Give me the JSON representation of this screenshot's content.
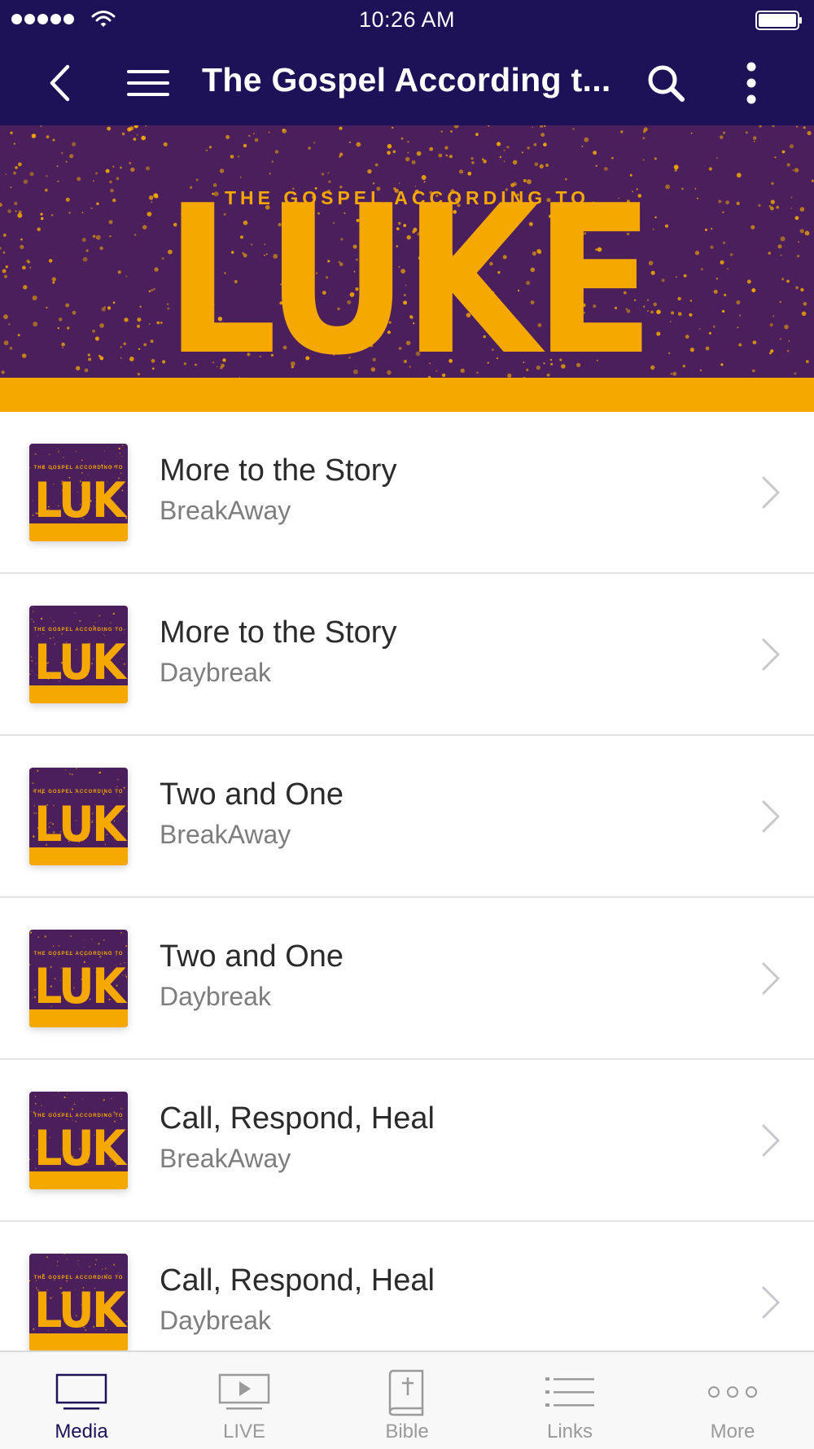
{
  "status_bar": {
    "time": "10:26 AM"
  },
  "nav": {
    "title": "The Gospel According t...",
    "icons": [
      "chevron-left-icon",
      "hamburger-menu-icon",
      "search-icon",
      "vertical-ellipsis-icon"
    ]
  },
  "banner": {
    "subtitle": "THE GOSPEL ACCORDING TO",
    "title": "LUKE"
  },
  "thumbnail": {
    "subtitle": "THE GOSPEL ACCORDING TO",
    "title": "LUKE"
  },
  "items": [
    {
      "title": "More to the Story",
      "subtitle": "BreakAway"
    },
    {
      "title": "More to the Story",
      "subtitle": "Daybreak"
    },
    {
      "title": "Two and One",
      "subtitle": "BreakAway"
    },
    {
      "title": "Two and One",
      "subtitle": "Daybreak"
    },
    {
      "title": "Call, Respond, Heal",
      "subtitle": "BreakAway"
    },
    {
      "title": "Call, Respond, Heal",
      "subtitle": "Daybreak"
    }
  ],
  "tabs": [
    {
      "label": "Media",
      "icon": "monitor-icon",
      "active": true
    },
    {
      "label": "LIVE",
      "icon": "play-screen-icon",
      "active": false
    },
    {
      "label": "Bible",
      "icon": "bible-icon",
      "active": false
    },
    {
      "label": "Links",
      "icon": "list-icon",
      "active": false
    },
    {
      "label": "More",
      "icon": "more-dots-icon",
      "active": false
    }
  ],
  "colors": {
    "nav_background": "#1d1157",
    "banner_purple": "#4a1f5c",
    "accent_gold": "#f5a800",
    "active_tab": "#1d1157",
    "inactive_tab": "#9a9a9a"
  }
}
